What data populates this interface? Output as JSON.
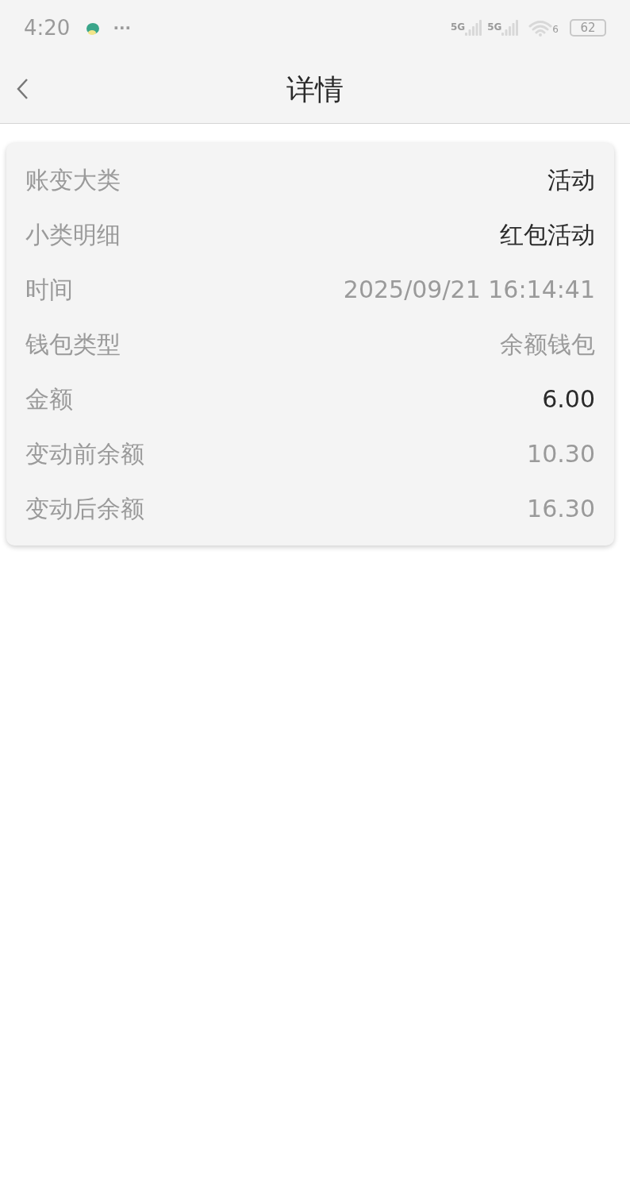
{
  "status_bar": {
    "time": "4:20",
    "more": "···",
    "signals": [
      "5G",
      "5G"
    ],
    "wifi_label": "6",
    "battery": "62"
  },
  "header": {
    "title": "详情"
  },
  "details": [
    {
      "label": "账变大类",
      "value": "活动",
      "kind": "strong"
    },
    {
      "label": "小类明细",
      "value": "红包活动",
      "kind": "strong"
    },
    {
      "label": "时间",
      "value": "2025/09/21 16:14:41",
      "kind": "muted"
    },
    {
      "label": "钱包类型",
      "value": "余额钱包",
      "kind": "muted"
    },
    {
      "label": "金额",
      "value": "6.00",
      "kind": "strong"
    },
    {
      "label": "变动前余额",
      "value": "10.30",
      "kind": "muted"
    },
    {
      "label": "变动后余额",
      "value": "16.30",
      "kind": "muted"
    }
  ]
}
